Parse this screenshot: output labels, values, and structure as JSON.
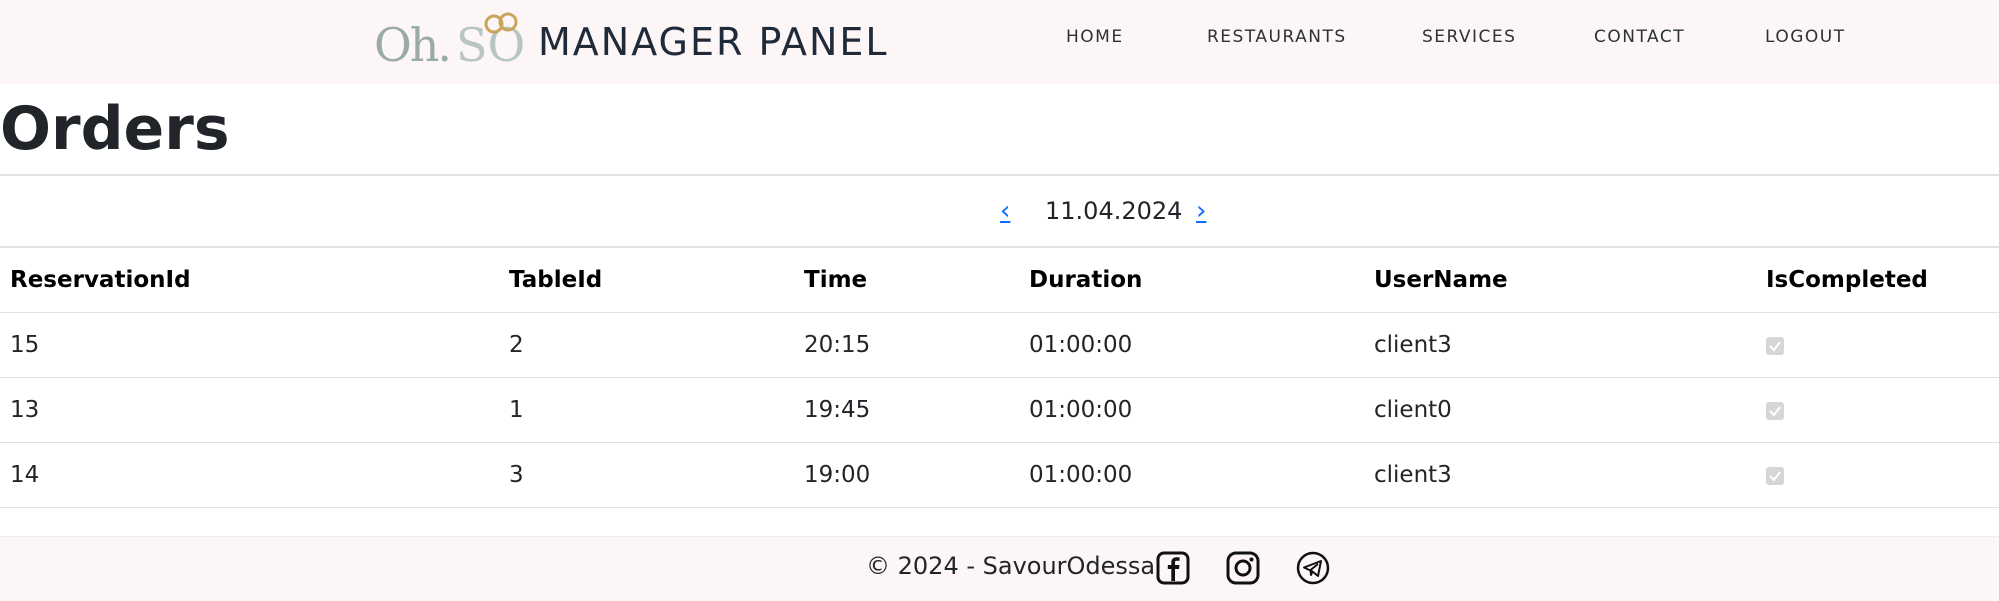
{
  "header": {
    "logo_text_oh": "Oh.",
    "logo_text_so": "SO",
    "brand_title": "MANAGER PANEL",
    "nav": [
      {
        "label": "HOME"
      },
      {
        "label": "RESTAURANTS"
      },
      {
        "label": "SERVICES"
      },
      {
        "label": "CONTACT"
      },
      {
        "label": "LOGOUT"
      }
    ]
  },
  "page": {
    "title": "Orders"
  },
  "date_nav": {
    "prev_glyph": "‹",
    "date": "11.04.2024",
    "next_glyph": "›"
  },
  "table": {
    "headers": [
      "ReservationId",
      "TableId",
      "Time",
      "Duration",
      "UserName",
      "IsCompleted"
    ],
    "rows": [
      {
        "reservation_id": "15",
        "table_id": "2",
        "time": "20:15",
        "duration": "01:00:00",
        "user_name": "client3",
        "is_completed": true
      },
      {
        "reservation_id": "13",
        "table_id": "1",
        "time": "19:45",
        "duration": "01:00:00",
        "user_name": "client0",
        "is_completed": true
      },
      {
        "reservation_id": "14",
        "table_id": "3",
        "time": "19:00",
        "duration": "01:00:00",
        "user_name": "client3",
        "is_completed": true
      }
    ]
  },
  "footer": {
    "copyright": "© 2024 - SavourOdessa",
    "social": [
      "facebook-icon",
      "instagram-icon",
      "telegram-icon"
    ]
  },
  "colors": {
    "header_bg": "#fdf6f6",
    "link_blue": "#0d6efd",
    "logo_gold": "#c9a45c",
    "logo_grey": "#9aaba7"
  }
}
